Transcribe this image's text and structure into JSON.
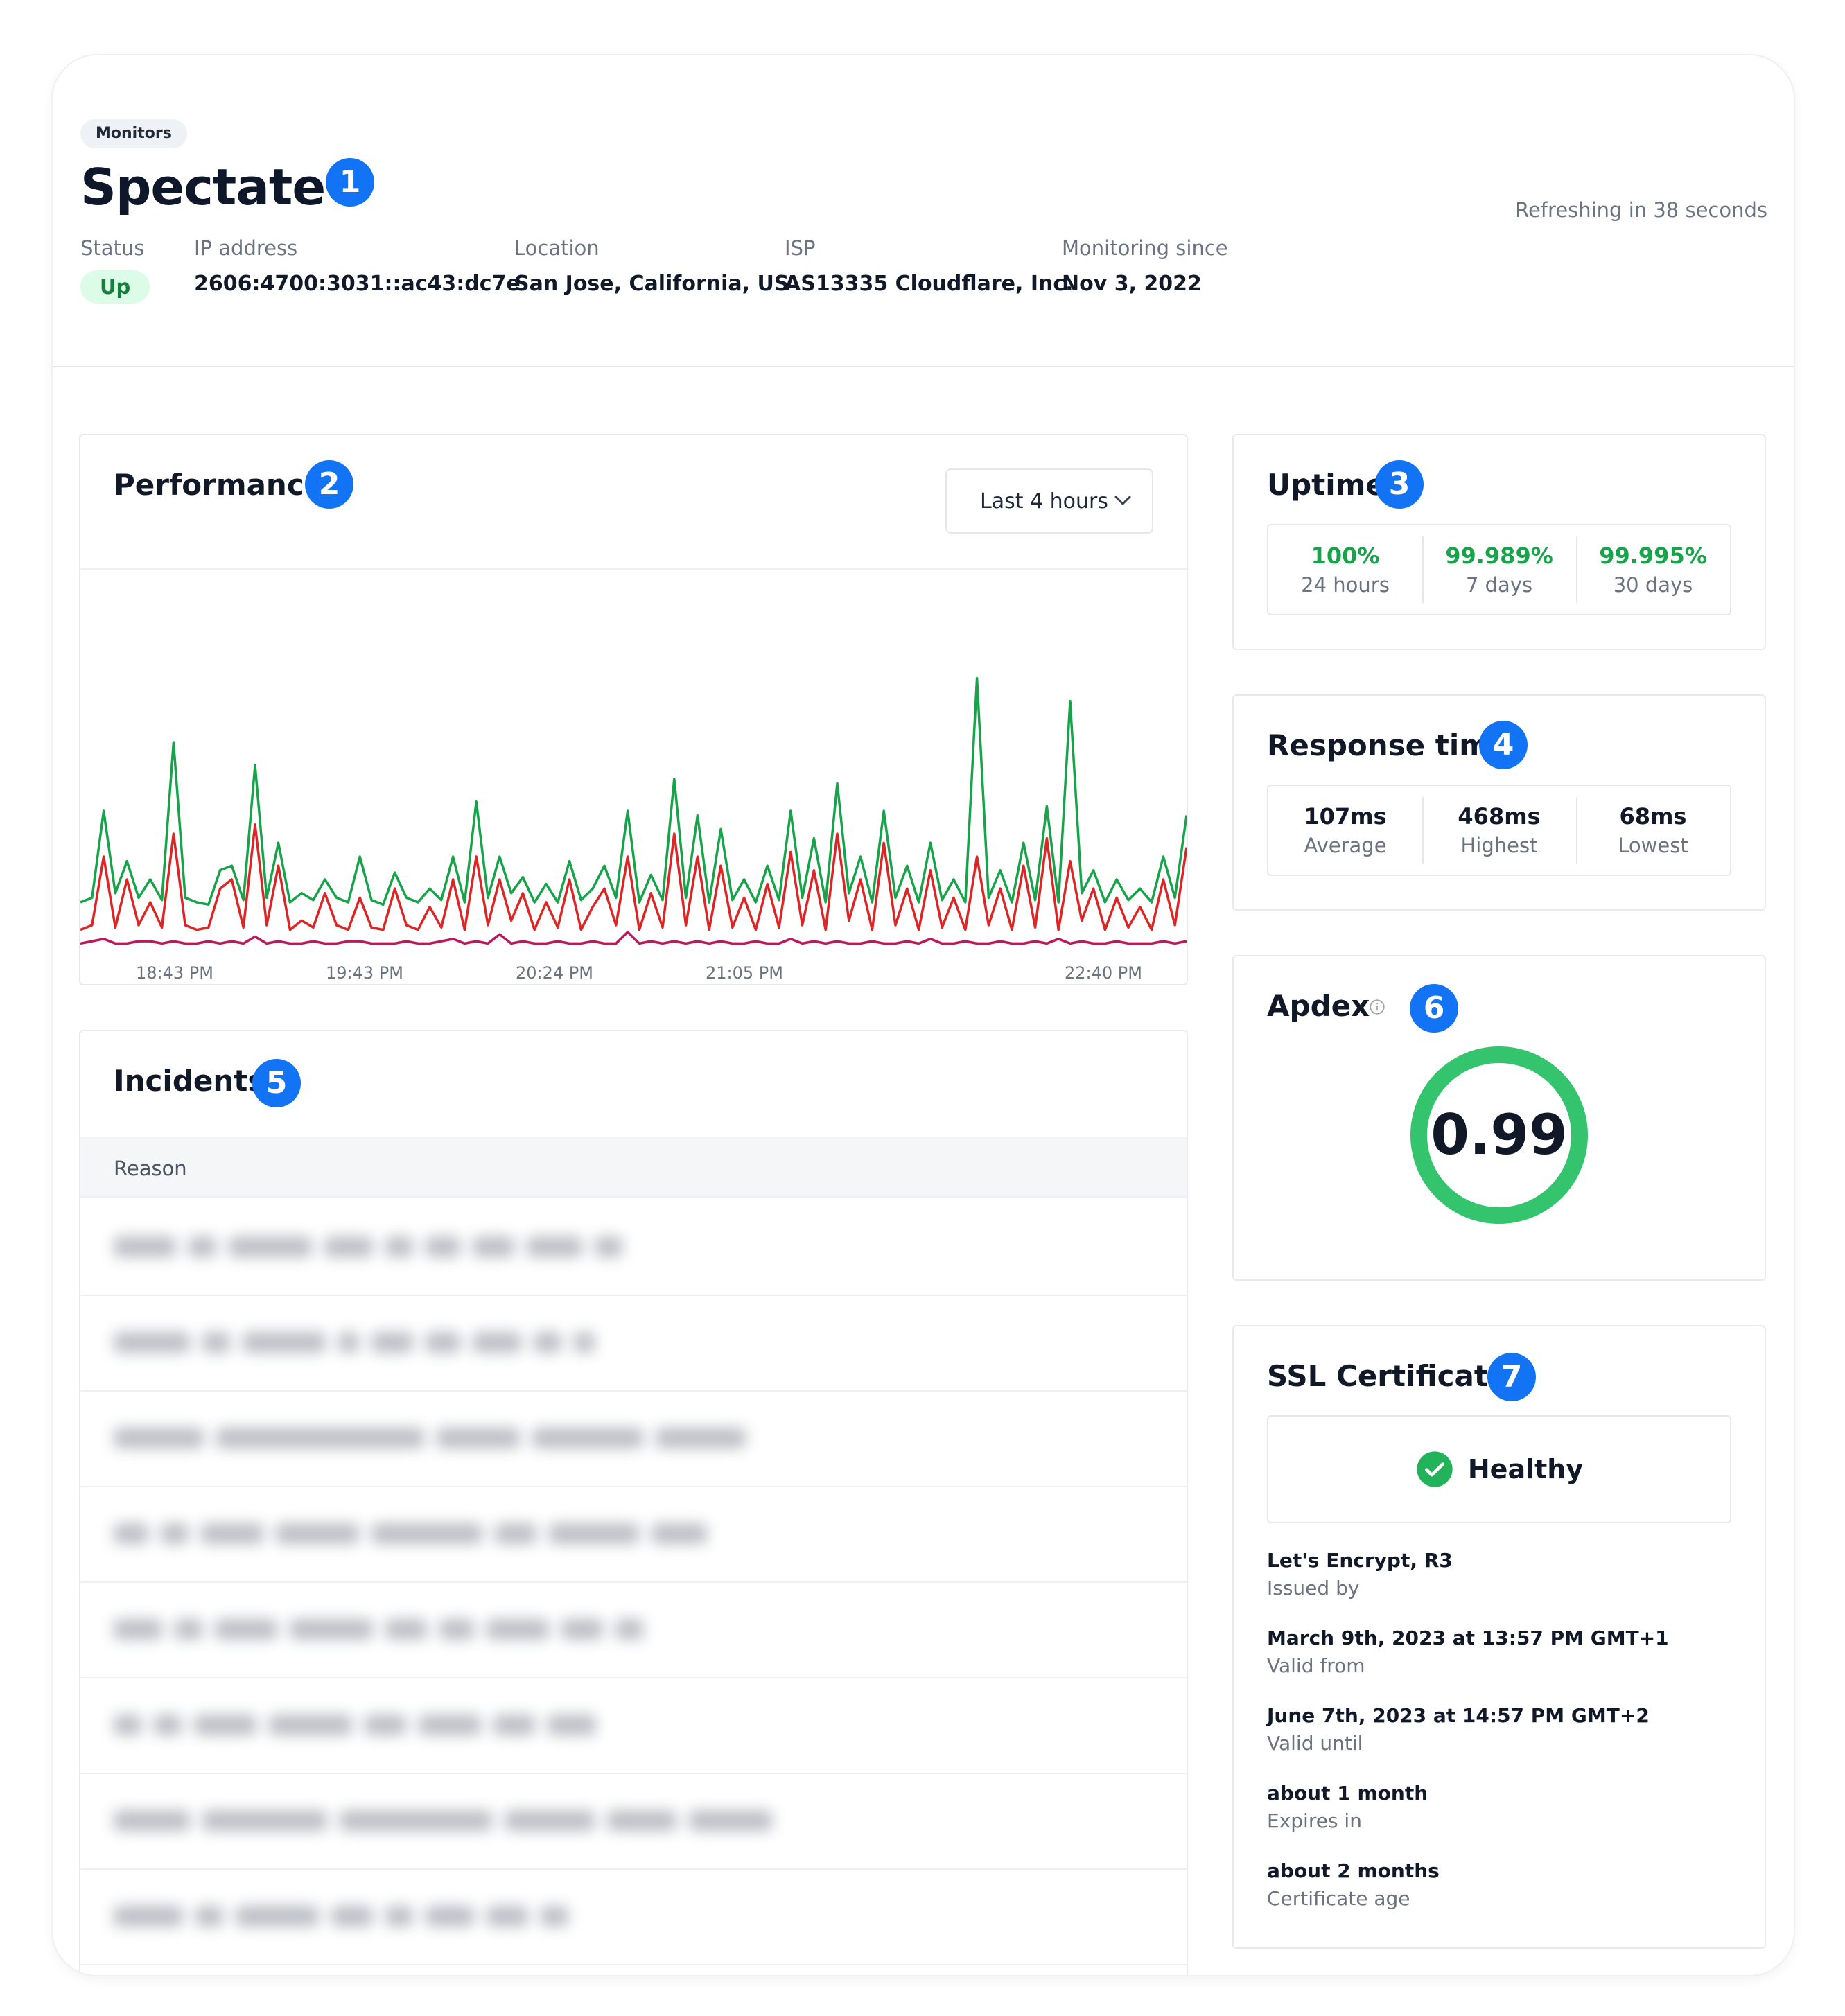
{
  "header": {
    "breadcrumb": "Monitors",
    "title": "Spectate",
    "refresh_text": "Refreshing in 38 seconds",
    "status_label": "Status",
    "status_value": "Up",
    "ip_label": "IP address",
    "ip_value": "2606:4700:3031::ac43:dc7e",
    "location_label": "Location",
    "location_value": "San Jose, California, US",
    "isp_label": "ISP",
    "isp_value": "AS13335 Cloudflare, Inc.",
    "since_label": "Monitoring since",
    "since_value": "Nov 3, 2022"
  },
  "badges": [
    "1",
    "2",
    "3",
    "4",
    "5",
    "6",
    "7"
  ],
  "performance": {
    "title": "Performance",
    "range_label": "Last 4 hours",
    "x_ticks": [
      "18:43 PM",
      "19:43 PM",
      "20:24 PM",
      "21:05 PM",
      "22:40 PM"
    ]
  },
  "chart_data": {
    "type": "line",
    "title": "Performance",
    "x": [
      "18:43 PM",
      "19:43 PM",
      "20:24 PM",
      "21:05 PM",
      "22:40 PM"
    ],
    "series": [
      {
        "color": "#16a34a",
        "values": [
          20,
          22,
          60,
          24,
          38,
          22,
          30,
          21,
          90,
          22,
          20,
          19,
          34,
          36,
          21,
          80,
          22,
          46,
          20,
          24,
          21,
          30,
          22,
          20,
          40,
          21,
          19,
          33,
          22,
          20,
          26,
          21,
          40,
          20,
          64,
          22,
          40,
          24,
          31,
          20,
          28,
          20,
          38,
          21,
          26,
          36,
          22,
          60,
          20,
          32,
          21,
          74,
          22,
          58,
          20,
          52,
          21,
          30,
          20,
          36,
          21,
          60,
          22,
          48,
          20,
          72,
          24,
          40,
          20,
          60,
          22,
          36,
          20,
          46,
          21,
          30,
          20,
          118,
          22,
          34,
          20,
          46,
          21,
          62,
          20,
          108,
          24,
          34,
          20,
          30,
          21,
          26,
          20,
          40,
          22,
          58
        ]
      },
      {
        "color": "#dc2626",
        "values": [
          8,
          10,
          40,
          9,
          30,
          10,
          20,
          9,
          50,
          10,
          8,
          9,
          26,
          30,
          9,
          54,
          10,
          36,
          8,
          12,
          9,
          24,
          10,
          8,
          22,
          9,
          8,
          26,
          10,
          8,
          18,
          9,
          30,
          8,
          40,
          10,
          30,
          12,
          24,
          8,
          20,
          9,
          30,
          8,
          18,
          26,
          10,
          40,
          8,
          24,
          9,
          50,
          10,
          40,
          8,
          36,
          9,
          22,
          8,
          28,
          9,
          42,
          10,
          34,
          8,
          50,
          12,
          30,
          8,
          46,
          10,
          26,
          8,
          34,
          9,
          22,
          8,
          40,
          10,
          26,
          8,
          36,
          9,
          48,
          8,
          38,
          12,
          26,
          8,
          22,
          9,
          18,
          8,
          30,
          10,
          44
        ]
      },
      {
        "color": "#be185d",
        "values": [
          2,
          3,
          4,
          2,
          2,
          3,
          3,
          2,
          3,
          2,
          2,
          3,
          2,
          3,
          2,
          5,
          2,
          3,
          2,
          2,
          3,
          2,
          2,
          3,
          3,
          2,
          2,
          2,
          3,
          2,
          2,
          3,
          4,
          2,
          3,
          2,
          6,
          2,
          3,
          2,
          2,
          3,
          2,
          2,
          3,
          2,
          2,
          7,
          2,
          3,
          2,
          3,
          2,
          3,
          2,
          3,
          2,
          2,
          3,
          2,
          2,
          4,
          2,
          3,
          2,
          3,
          2,
          2,
          3,
          2,
          2,
          3,
          2,
          4,
          2,
          2,
          3,
          2,
          2,
          3,
          2,
          2,
          3,
          2,
          4,
          2,
          3,
          2,
          2,
          3,
          2,
          2,
          2,
          3,
          2,
          3
        ]
      }
    ]
  },
  "uptime": {
    "title": "Uptime",
    "stats": [
      {
        "value": "100%",
        "label": "24 hours"
      },
      {
        "value": "99.989%",
        "label": "7 days"
      },
      {
        "value": "99.995%",
        "label": "30 days"
      }
    ]
  },
  "response": {
    "title": "Response time",
    "stats": [
      {
        "value": "107ms",
        "label": "Average"
      },
      {
        "value": "468ms",
        "label": "Highest"
      },
      {
        "value": "68ms",
        "label": "Lowest"
      }
    ]
  },
  "apdex": {
    "title": "Apdex",
    "value": "0.99",
    "ring_color": "#34c46e"
  },
  "ssl": {
    "title": "SSL Certificate",
    "status": "Healthy",
    "items": [
      {
        "value": "Let's Encrypt, R3",
        "label": "Issued by"
      },
      {
        "value": "March 9th, 2023 at 13:57 PM GMT+1",
        "label": "Valid from"
      },
      {
        "value": "June 7th, 2023 at 14:57 PM GMT+2",
        "label": "Valid until"
      },
      {
        "value": "about 1 month",
        "label": "Expires in"
      },
      {
        "value": "about 2 months",
        "label": "Certificate age"
      }
    ]
  },
  "incidents": {
    "title": "Incidents",
    "column": "Reason"
  },
  "icons": {
    "range_dropdown": "chevron-down-icon",
    "apdex_info": "info-icon",
    "ssl_status": "check-circle-icon"
  },
  "colors": {
    "accent": "#1273f5",
    "success": "#16a34a"
  }
}
